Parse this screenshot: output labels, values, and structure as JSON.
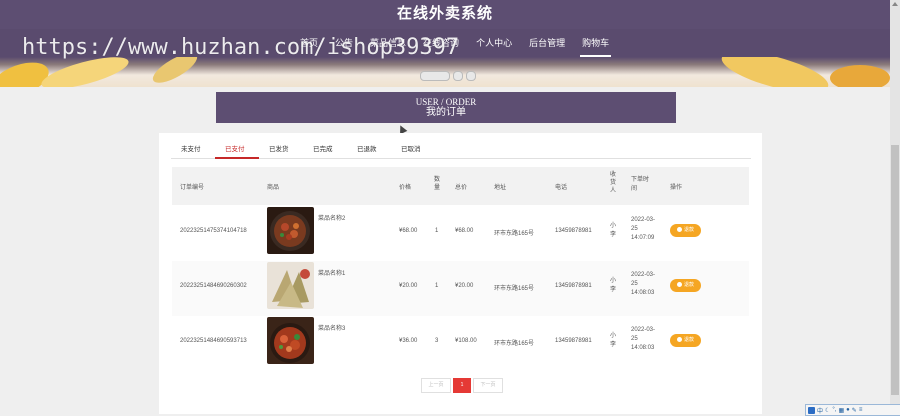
{
  "app": {
    "title": "在线外卖系统"
  },
  "watermark": "https://www.huzhan.com/ishop39397",
  "nav": {
    "items": [
      {
        "label": "首页",
        "active": false
      },
      {
        "label": "公告",
        "active": false
      },
      {
        "label": "菜品信息",
        "active": false
      },
      {
        "label": "在线咨询",
        "active": false
      },
      {
        "label": "个人中心",
        "active": false
      },
      {
        "label": "后台管理",
        "active": false
      },
      {
        "label": "购物车",
        "active": true
      }
    ]
  },
  "page": {
    "title_en": "USER / ORDER",
    "title_cn": "我的订单"
  },
  "tabs": [
    "未支付",
    "已支付",
    "已发货",
    "已完成",
    "已退款",
    "已取消"
  ],
  "active_tab": "已支付",
  "table": {
    "headers": [
      "订单编号",
      "商品",
      "价格",
      "数量",
      "总价",
      "地址",
      "电话",
      "收货人",
      "下单时间",
      "操作"
    ],
    "rows": [
      {
        "order_no": "20223251475374104718",
        "product": "菜品名称2",
        "price": "¥68.00",
        "qty": "1",
        "total": "¥68.00",
        "address": "环市东路165号",
        "phone": "13459878981",
        "receiver": "小李",
        "time": "2022-03-25 14:07:09",
        "action": "退款"
      },
      {
        "order_no": "20223251484690260302",
        "product": "菜品名称1",
        "price": "¥20.00",
        "qty": "1",
        "total": "¥20.00",
        "address": "环市东路165号",
        "phone": "13459878981",
        "receiver": "小李",
        "time": "2022-03-25 14:08:03",
        "action": "退款"
      },
      {
        "order_no": "20223251484690593713",
        "product": "菜品名称3",
        "price": "¥36.00",
        "qty": "3",
        "total": "¥108.00",
        "address": "环市东路165号",
        "phone": "13459878981",
        "receiver": "小李",
        "time": "2022-03-25 14:08:03",
        "action": "退款"
      }
    ]
  },
  "pager": {
    "prev": "上一页",
    "current": "1",
    "next": "下一页"
  },
  "colors": {
    "brand": "#5d4e72",
    "accent": "#f5a623",
    "active_red": "#c62828"
  }
}
